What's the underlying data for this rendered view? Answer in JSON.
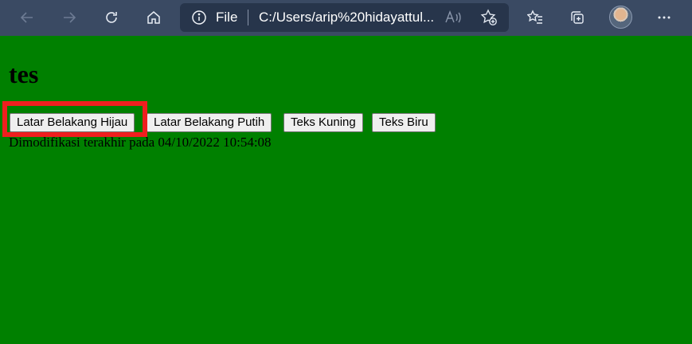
{
  "browser": {
    "address_label": "File",
    "url": "C:/Users/arip%20hidayattul...",
    "icons": {
      "back": "back-arrow-icon",
      "forward": "forward-arrow-icon",
      "refresh": "refresh-icon",
      "home": "home-icon",
      "info": "info-icon",
      "read_aloud": "read-aloud-icon",
      "favorite": "add-favorite-icon",
      "favorites": "favorites-icon",
      "collections": "collections-icon",
      "profile": "profile-avatar",
      "more": "more-icon"
    }
  },
  "page": {
    "heading": "tes",
    "buttons": [
      "Latar Belakang Hijau",
      "Latar Belakang Putih",
      "Teks Kuning",
      "Teks Biru"
    ],
    "status": "Dimodifikasi terakhir pada 04/10/2022 10:54:08",
    "background_color": "#008000"
  },
  "annotation": {
    "highlight_color": "#ef1f1f"
  }
}
